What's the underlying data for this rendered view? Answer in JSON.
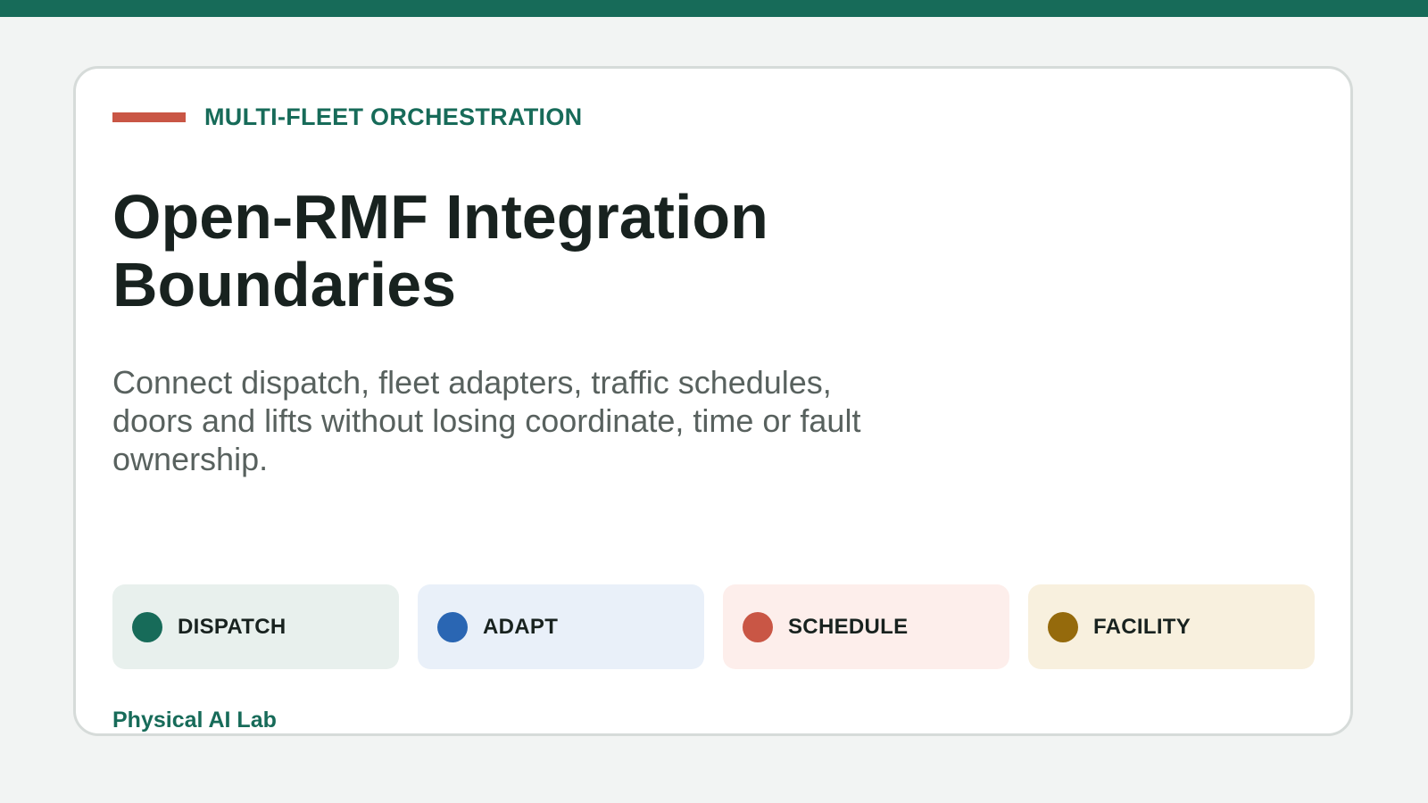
{
  "eyebrow": "MULTI-FLEET ORCHESTRATION",
  "title_lines": [
    "Open-RMF Integration",
    "Boundaries"
  ],
  "subtitle": "Connect dispatch, fleet adapters, traffic schedules, doors and lifts without losing coordinate, time or fault ownership.",
  "chips": [
    {
      "label": "DISPATCH",
      "dot_color": "#176b59",
      "bg_color": "#e8f0ed"
    },
    {
      "label": "ADAPT",
      "dot_color": "#2a66b3",
      "bg_color": "#e9f0f9"
    },
    {
      "label": "SCHEDULE",
      "dot_color": "#c95645",
      "bg_color": "#fdeeeb"
    },
    {
      "label": "FACILITY",
      "dot_color": "#956a0c",
      "bg_color": "#f8f0de"
    }
  ],
  "footer": "Physical AI Lab",
  "colors": {
    "brand": "#176b59",
    "accent": "#c95645",
    "page_bg": "#f2f4f3"
  }
}
